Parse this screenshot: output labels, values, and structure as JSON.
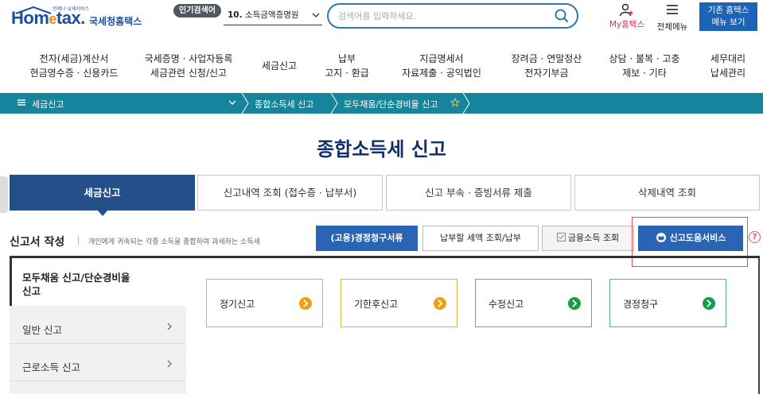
{
  "header": {
    "logo_tagline": "언제나 납세서비스",
    "logo_text": "Hometax",
    "logo_korean": "국세청홈택스",
    "popular_badge": "인기검색어",
    "popular_rank": "10.",
    "popular_term": "소득금액증명원",
    "search_placeholder": "검색어를 입력하세요.",
    "my_hometax": "My홈택스",
    "all_menu": "전체메뉴",
    "old_home_line1": "기존 홈택스",
    "old_home_line2": "메뉴 보기"
  },
  "nav": {
    "items": [
      {
        "line1": "전자(세금)계산서",
        "line2": "현금영수증 · 신용카드"
      },
      {
        "line1": "국세증명 · 사업자등록",
        "line2": "세금관련 신청/신고"
      },
      {
        "line1": "세금신고",
        "line2": ""
      },
      {
        "line1": "납부",
        "line2": "고지 · 환급"
      },
      {
        "line1": "지급명세서",
        "line2": "자료제출 · 공익법인"
      },
      {
        "line1": "장려금 · 연말정산",
        "line2": "전자기부금"
      },
      {
        "line1": "상담 · 불복 · 고충",
        "line2": "제보 · 기타"
      },
      {
        "line1": "세무대리",
        "line2": "납세관리"
      }
    ]
  },
  "breadcrumb": {
    "level1": "세금신고",
    "level2": "종합소득세 신고",
    "level3": "모두채움/단순경비율 신고"
  },
  "page_title": "종합소득세 신고",
  "tabs": [
    {
      "label": "세금신고",
      "active": true
    },
    {
      "label": "신고내역 조회 (접수증 · 납부서)",
      "active": false
    },
    {
      "label": "신고 부속 · 증빙서류 제출",
      "active": false
    },
    {
      "label": "삭제내역 조회",
      "active": false
    }
  ],
  "section": {
    "title": "신고서 작성",
    "description": "개인에게 귀속되는 각종 소득을 종합하여 과세하는 소득세"
  },
  "actions": {
    "claim": "(고용)경정청구서류",
    "tax_due": "납부할 세액 조회/납부",
    "finance_income": "금융소득 조회",
    "help_service": "신고도움서비스",
    "help_mark": "?"
  },
  "side_menu": {
    "selected_line1": "모두채움 신고/단순경비율",
    "selected_line2": "신고",
    "items": [
      "일반 신고",
      "근로소득 신고"
    ]
  },
  "cards": [
    {
      "label": "정기신고",
      "color": "#f0a012"
    },
    {
      "label": "기한후신고",
      "color": "#f0a012"
    },
    {
      "label": "수정신고",
      "color": "#1a9d4c"
    },
    {
      "label": "경정청구",
      "color": "#1a9d4c"
    }
  ],
  "colors": {
    "brand_blue": "#1b4fa0",
    "breadcrumb_teal": "#16849a",
    "active_tab": "#254f88",
    "highlight_red": "#e2534e"
  }
}
